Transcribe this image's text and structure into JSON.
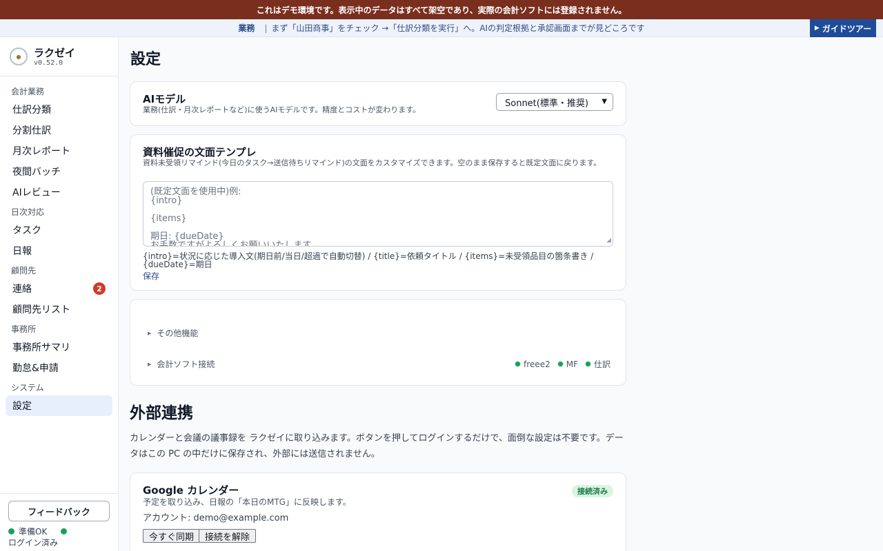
{
  "banner": {
    "text": "これはデモ環境です。表示中のデータはすべて架空であり、実際の会計ソフトには登録されません。"
  },
  "guide": {
    "category": "業務",
    "separator": "|",
    "text": "まず「山田商事」をチェック →「仕訳分類を実行」へ。AIの判定根拠と承認画面までが見どころです",
    "tour_label": "ガイドツアー"
  },
  "sidebar": {
    "app_name": "ラクゼイ",
    "version": "v0.52.0",
    "sections": [
      {
        "label": "会計業務",
        "items": [
          {
            "label": "仕訳分類"
          },
          {
            "label": "分割仕訳"
          },
          {
            "label": "月次レポート"
          },
          {
            "label": "夜間バッチ"
          },
          {
            "label": "AIレビュー"
          }
        ]
      },
      {
        "label": "日次対応",
        "items": [
          {
            "label": "タスク"
          },
          {
            "label": "日報"
          }
        ]
      },
      {
        "label": "顧問先",
        "items": [
          {
            "label": "連絡",
            "badge": "2"
          },
          {
            "label": "顧問先リスト"
          }
        ]
      },
      {
        "label": "事務所",
        "items": [
          {
            "label": "事務所サマリ"
          },
          {
            "label": "勤怠&申請"
          }
        ]
      },
      {
        "label": "システム",
        "items": [
          {
            "label": "設定",
            "active": true
          }
        ]
      }
    ],
    "feedback_label": "フィードバック",
    "status_ready": "準備OK",
    "login_status": "ログイン済み"
  },
  "main": {
    "title": "設定",
    "ai_model": {
      "title": "AIモデル",
      "description": "業務(仕訳・月次レポートなど)に使うAIモデルです。精度とコストが変わります。",
      "selected": "Sonnet(標準・推奨)"
    },
    "template": {
      "title": "資料催促の文面テンプレ",
      "description": "資料未受領リマインド(今日のタスク→送信待ちリマインド)の文面をカスタマイズできます。空のまま保存すると既定文面に戻ります。",
      "placeholder_lines": [
        "(既定文面を使用中)例:",
        "{intro}",
        "",
        "{items}",
        "",
        "期日: {dueDate}",
        "お手数ですがよろしくお願いいたします。"
      ],
      "help": "{intro}=状況に応じた導入文(期日前/当日/超過で自動切替) / {title}=依頼タイトル / {items}=未受領品目の箇条書き / {dueDate}=期日",
      "save_label": "保存"
    },
    "other": {
      "other_features_label": "その他機能",
      "accounting_link_label": "会計ソフト接続",
      "connections": [
        {
          "label": "freee2"
        },
        {
          "label": "MF"
        },
        {
          "label": "仕訳"
        }
      ]
    },
    "external": {
      "title": "外部連携",
      "description": "カレンダーと会議の議事録を ラクゼイに取り込みます。ボタンを押してログインするだけで、面倒な設定は不要です。データはこの PC の中だけに保存され、外部には送信されません。"
    },
    "google_calendar": {
      "title": "Google カレンダー",
      "description": "予定を取り込み、日報の「本日のMTG」に反映します。",
      "status": "接続済み",
      "account": "アカウント: demo@example.com",
      "sync_label": "今すぐ同期",
      "disconnect_label": "接続を解除"
    }
  },
  "colors": {
    "banner": "#7a2e1e",
    "accent": "#1e4b9a",
    "status_green": "#17a05d",
    "badge_red": "#d03a2a"
  }
}
